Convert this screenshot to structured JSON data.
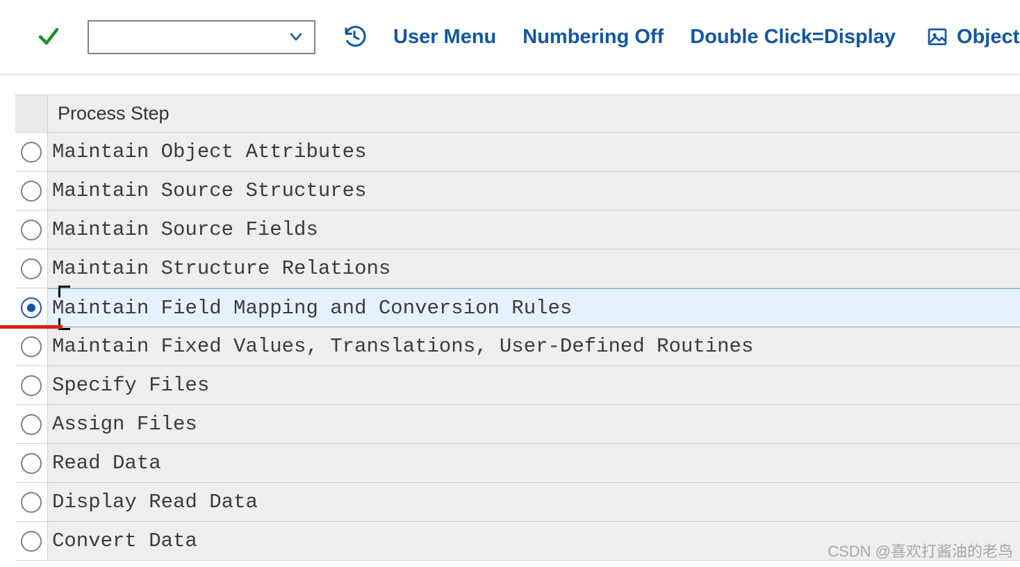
{
  "toolbar": {
    "user_menu": "User Menu",
    "numbering": "Numbering Off",
    "dbl_click": "Double Click=Display",
    "object": "Object"
  },
  "table": {
    "header": "Process Step",
    "rows": [
      {
        "label": "Maintain Object Attributes",
        "selected": false
      },
      {
        "label": "Maintain Source Structures",
        "selected": false
      },
      {
        "label": "Maintain Source Fields",
        "selected": false
      },
      {
        "label": "Maintain Structure Relations",
        "selected": false
      },
      {
        "label": "Maintain Field Mapping and Conversion Rules",
        "selected": true
      },
      {
        "label": "Maintain Fixed Values, Translations, User-Defined Routines",
        "selected": false
      },
      {
        "label": "Specify Files",
        "selected": false
      },
      {
        "label": "Assign Files",
        "selected": false
      },
      {
        "label": "Read Data",
        "selected": false
      },
      {
        "label": "Display Read Data",
        "selected": false
      },
      {
        "label": "Convert Data",
        "selected": false
      }
    ]
  },
  "watermark": "CSDN @喜欢打酱油的老鸟"
}
